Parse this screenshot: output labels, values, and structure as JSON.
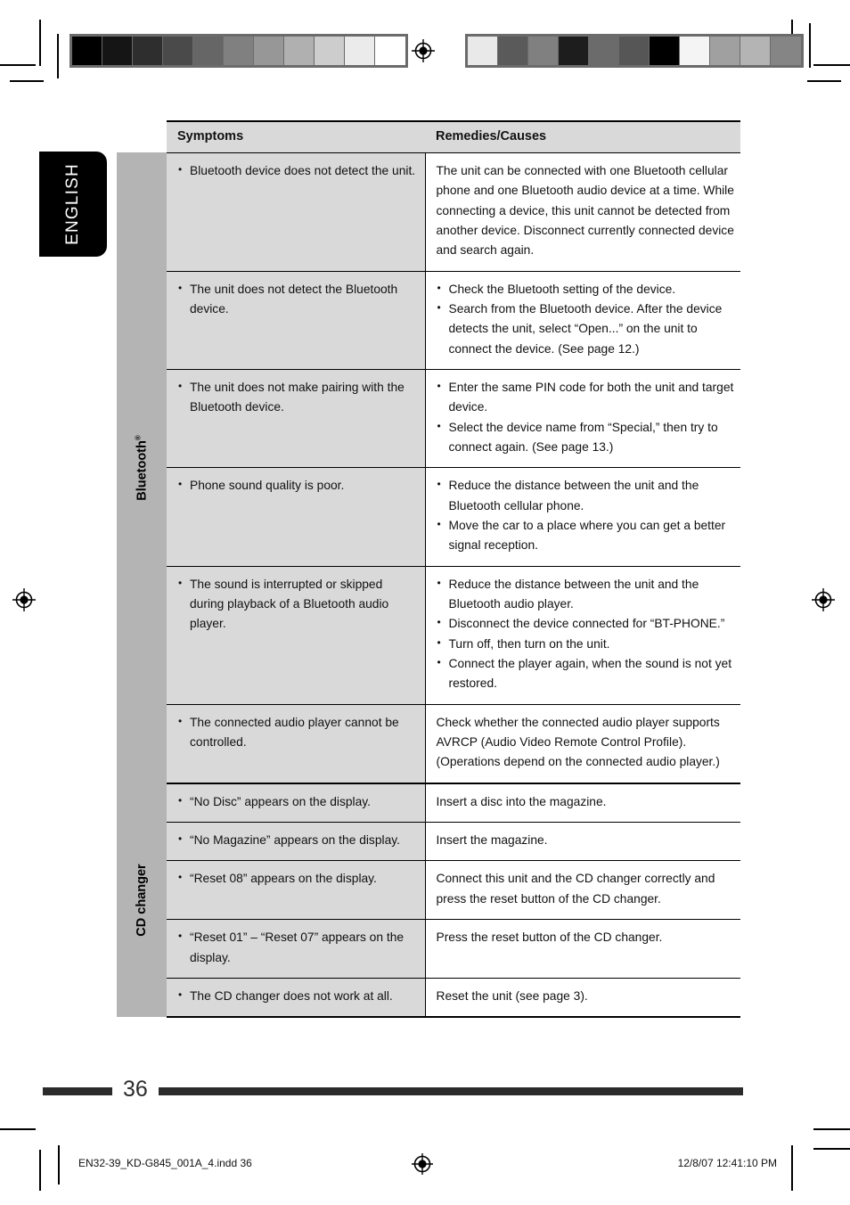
{
  "page": {
    "language_tab": "ENGLISH",
    "page_number": "36"
  },
  "calibration": {
    "left_strip": [
      "#000000",
      "#151515",
      "#2e2e2e",
      "#4a4a4a",
      "#666666",
      "#808080",
      "#979797",
      "#b0b0b0",
      "#cdcdcd",
      "#ebebeb",
      "#ffffff"
    ],
    "right_strip": [
      "#e9e9e9",
      "#5a5a5a",
      "#808080",
      "#1d1d1d",
      "#6b6b6b",
      "#565656",
      "#000000",
      "#f4f4f4",
      "#a0a0a0",
      "#b4b4b4",
      "#858585"
    ]
  },
  "table": {
    "headers": {
      "symptoms": "Symptoms",
      "remedies": "Remedies/Causes"
    },
    "sections": [
      {
        "label": "Bluetooth",
        "label_mark": "®",
        "rows": [
          {
            "symptoms": [
              "Bluetooth device does not detect the unit."
            ],
            "remedies_plain": "The unit can be connected with one Bluetooth cellular phone and one Bluetooth audio device at a time. While connecting a device, this unit cannot be detected from another device. Disconnect currently connected device and search again.",
            "remedies": []
          },
          {
            "symptoms": [
              "The unit does not detect the Bluetooth device."
            ],
            "remedies_plain": "",
            "remedies": [
              "Check the Bluetooth setting of the device.",
              "Search from the Bluetooth device. After the device detects the unit, select “Open...” on the unit to connect the device. (See page 12.)"
            ]
          },
          {
            "symptoms": [
              "The unit does not make pairing with the Bluetooth device."
            ],
            "remedies_plain": "",
            "remedies": [
              "Enter the same PIN code for both the unit and target device.",
              "Select the device name from “Special,” then try to connect again. (See page 13.)"
            ]
          },
          {
            "symptoms": [
              "Phone sound quality is poor."
            ],
            "remedies_plain": "",
            "remedies": [
              "Reduce the distance between the unit and the Bluetooth cellular phone.",
              "Move the car to a place where you can get a better signal reception."
            ]
          },
          {
            "symptoms": [
              "The sound is interrupted or skipped during playback of a Bluetooth audio player."
            ],
            "remedies_plain": "",
            "remedies": [
              "Reduce the distance between the unit and the Bluetooth audio player.",
              "Disconnect the device connected for “BT-PHONE.”",
              "Turn off, then turn on the unit.",
              "Connect the player again, when the sound is not yet restored."
            ]
          },
          {
            "symptoms": [
              "The connected audio player cannot be controlled."
            ],
            "remedies_plain": "Check whether the connected audio player supports AVRCP (Audio Video Remote Control Profile). (Operations depend on the connected audio player.)",
            "remedies": []
          }
        ]
      },
      {
        "label": "CD changer",
        "label_mark": "",
        "rows": [
          {
            "symptoms": [
              "“No Disc” appears on the display."
            ],
            "remedies_plain": "Insert a disc into the magazine.",
            "remedies": []
          },
          {
            "symptoms": [
              "“No Magazine” appears on the display."
            ],
            "remedies_plain": "Insert the magazine.",
            "remedies": []
          },
          {
            "symptoms": [
              "“Reset 08” appears on the display."
            ],
            "remedies_plain": "Connect this unit and the CD changer correctly and press the reset button of the CD changer.",
            "remedies": []
          },
          {
            "symptoms": [
              "“Reset 01” – “Reset 07” appears on the display."
            ],
            "remedies_plain": "Press the reset button of the CD changer.",
            "remedies": []
          },
          {
            "symptoms": [
              "The CD changer does not work at all."
            ],
            "remedies_plain": "Reset the unit (see page 3).",
            "remedies": []
          }
        ]
      }
    ]
  },
  "imprint": {
    "filename": "EN32-39_KD-G845_001A_4.indd   36",
    "timestamp": "12/8/07   12:41:10 PM"
  }
}
